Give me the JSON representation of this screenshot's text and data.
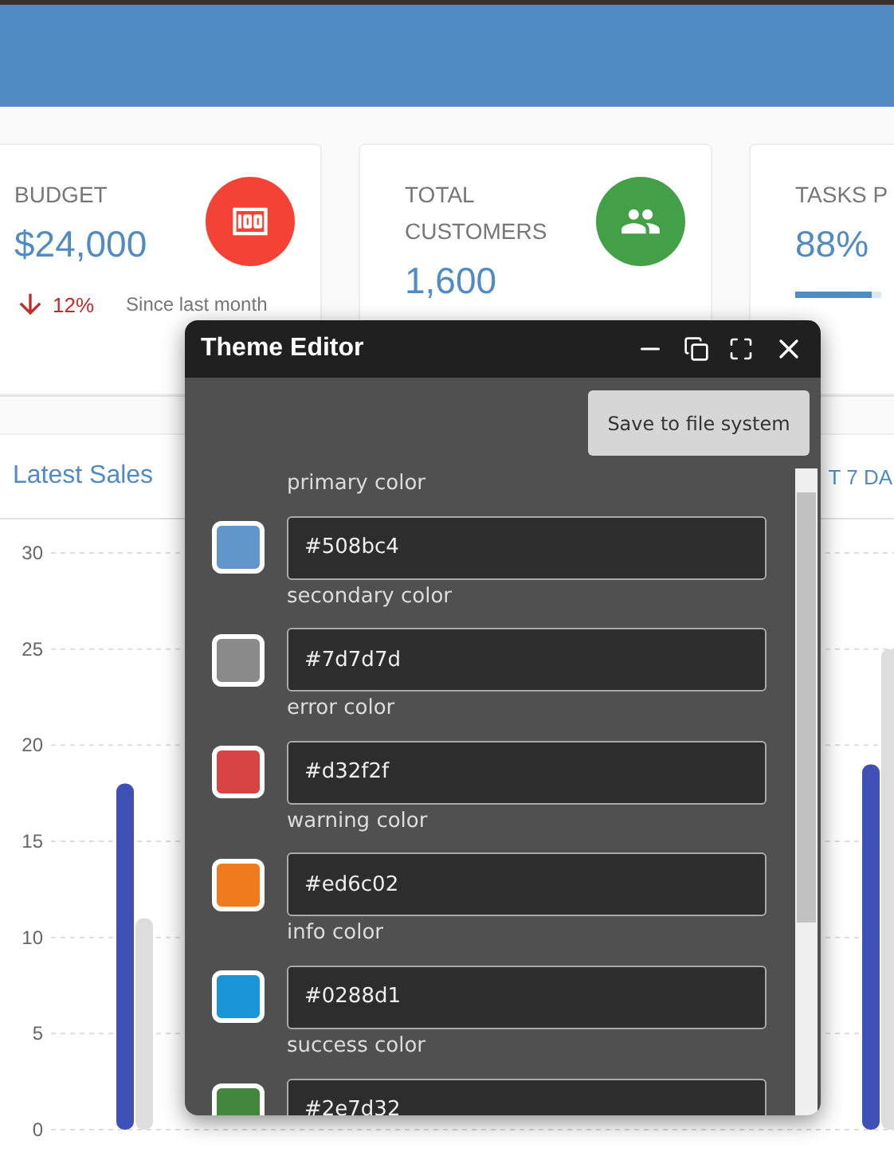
{
  "stats": [
    {
      "kind": "budget",
      "title": "BUDGET",
      "value": "$24,000",
      "falling": true,
      "change": "12%",
      "note": "Since last month"
    },
    {
      "kind": "customers",
      "title": "TOTAL CUSTOMERS",
      "value": "1,600"
    },
    {
      "kind": "progress",
      "title": "TASKS P",
      "value": "88%",
      "level": 0.88
    }
  ],
  "sales": {
    "title": "Latest Sales",
    "range": "T 7 DA",
    "chart_data": {
      "type": "bar",
      "grid": true,
      "ylim": [
        0,
        30
      ],
      "yticks": [
        0,
        5,
        10,
        15,
        20,
        25,
        30
      ],
      "series": [
        {
          "color": "#3f51b5",
          "values": [
            18,
            null,
            null,
            null,
            null,
            19
          ]
        },
        {
          "color": "#dddddd",
          "values": [
            11,
            null,
            null,
            null,
            null,
            25
          ]
        }
      ]
    }
  },
  "theme_editor": {
    "title": "Theme Editor",
    "save_button": "Save to file system",
    "colors": [
      {
        "label": "primary color",
        "value": "#508bc4",
        "color": "#6096ca"
      },
      {
        "label": "secondary color",
        "value": "#7d7d7d",
        "color": "#8a8a8a"
      },
      {
        "label": "error color",
        "value": "#d32f2f",
        "color": "#d84444"
      },
      {
        "label": "warning color",
        "value": "#ed6c02",
        "color": "#ef7b1c"
      },
      {
        "label": "info color",
        "value": "#0288d1",
        "color": "#1a95d8"
      },
      {
        "label": "success color",
        "value": "#2e7d32",
        "color": "#43873f"
      }
    ]
  }
}
